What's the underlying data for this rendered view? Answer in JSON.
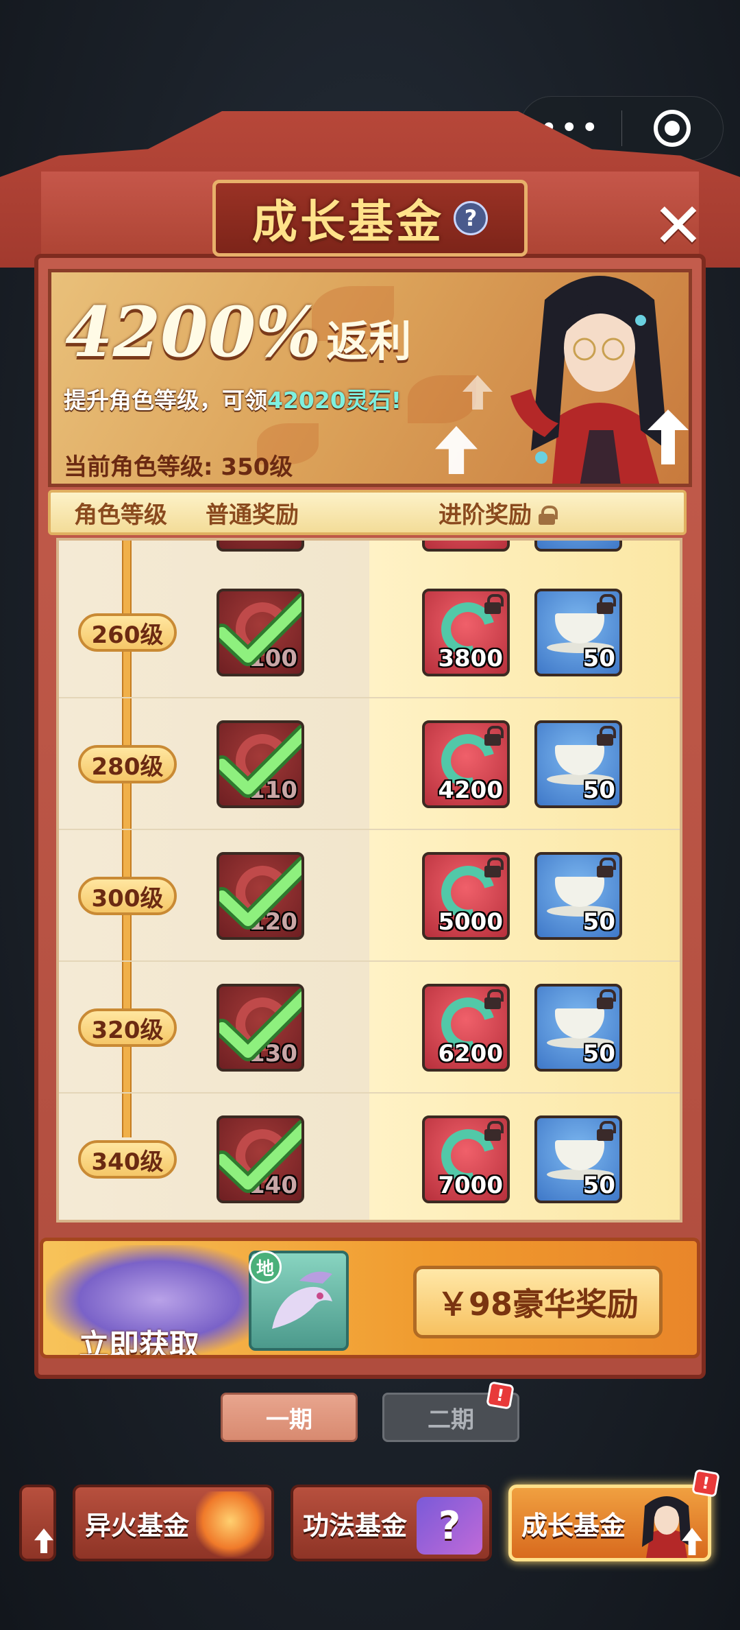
{
  "capsule": {
    "more_icon": "more-dots-icon",
    "close_icon": "target-icon"
  },
  "header": {
    "title": "成长基金",
    "help_label": "?",
    "close_label": "✕"
  },
  "banner": {
    "rebate_number": "4200%",
    "rebate_text": "返利",
    "promo_prefix": "提升角色等级，可领",
    "promo_highlight": "42020灵石!",
    "current_level": "当前角色等级: 350级"
  },
  "columns": {
    "level": "角色等级",
    "normal": "普通奖励",
    "advanced": "进阶奖励"
  },
  "rows": [
    {
      "level": "260级",
      "normal_amount": "100",
      "stone_amount": "3800",
      "tea_amount": "50"
    },
    {
      "level": "280级",
      "normal_amount": "110",
      "stone_amount": "4200",
      "tea_amount": "50"
    },
    {
      "level": "300级",
      "normal_amount": "120",
      "stone_amount": "5000",
      "tea_amount": "50"
    },
    {
      "level": "320级",
      "normal_amount": "130",
      "stone_amount": "6200",
      "tea_amount": "50"
    },
    {
      "level": "340级",
      "normal_amount": "140",
      "stone_amount": "7000",
      "tea_amount": "50"
    }
  ],
  "purchase": {
    "get_now": "立即获取",
    "pet_tag": "地",
    "button": "￥98豪华奖励"
  },
  "periods": {
    "first": "一期",
    "second": "二期",
    "badge": "!"
  },
  "bottom_tabs": [
    {
      "label": "异火基金"
    },
    {
      "label": "功法基金"
    },
    {
      "label": "成长基金",
      "badge": "!"
    }
  ],
  "colors": {
    "accent": "#f0a040",
    "title": "#ffe28a",
    "highlight": "#7ef0e0",
    "badge": "#e83a3a"
  }
}
